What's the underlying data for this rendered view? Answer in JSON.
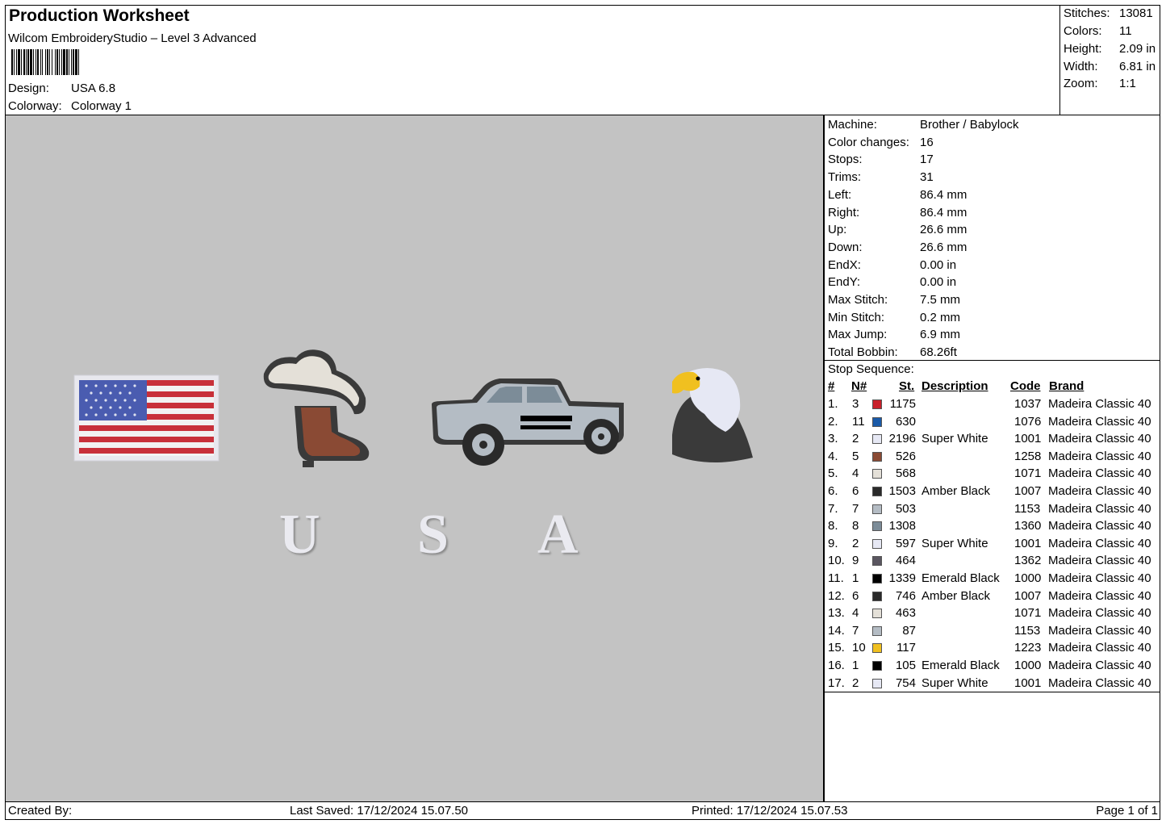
{
  "header": {
    "title": "Production Worksheet",
    "software": "Wilcom EmbroideryStudio – Level 3 Advanced",
    "design_label": "Design:",
    "design_value": "USA 6.8",
    "colorway_label": "Colorway:",
    "colorway_value": "Colorway 1"
  },
  "stats": [
    {
      "label": "Stitches:",
      "value": "13081"
    },
    {
      "label": "Colors:",
      "value": "11"
    },
    {
      "label": "Height:",
      "value": "2.09 in"
    },
    {
      "label": "Width:",
      "value": "6.81 in"
    },
    {
      "label": "Zoom:",
      "value": "1:1"
    }
  ],
  "machine_info": [
    {
      "label": "Machine:",
      "value": "Brother / Babylock"
    },
    {
      "label": "Color changes:",
      "value": "16"
    },
    {
      "label": "Stops:",
      "value": "17"
    },
    {
      "label": "Trims:",
      "value": "31"
    },
    {
      "label": "Left:",
      "value": "86.4 mm"
    },
    {
      "label": "Right:",
      "value": "86.4 mm"
    },
    {
      "label": "Up:",
      "value": "26.6 mm"
    },
    {
      "label": "Down:",
      "value": "26.6 mm"
    },
    {
      "label": "EndX:",
      "value": "0.00 in"
    },
    {
      "label": "EndY:",
      "value": "0.00 in"
    },
    {
      "label": "Max Stitch:",
      "value": "7.5 mm"
    },
    {
      "label": "Min Stitch:",
      "value": "0.2 mm"
    },
    {
      "label": "Max Jump:",
      "value": "6.9 mm"
    },
    {
      "label": "Total Bobbin:",
      "value": "68.26ft"
    }
  ],
  "stop_sequence": {
    "title": "Stop Sequence:",
    "columns": {
      "num": "#",
      "n": "N#",
      "st": "St.",
      "description": "Description",
      "code": "Code",
      "brand": "Brand"
    },
    "rows": [
      {
        "num": "1.",
        "n": "3",
        "color": "#c8202a",
        "st": "1175",
        "description": "",
        "code": "1037",
        "brand": "Madeira Classic 40"
      },
      {
        "num": "2.",
        "n": "11",
        "color": "#1a5aa8",
        "st": "630",
        "description": "",
        "code": "1076",
        "brand": "Madeira Classic 40"
      },
      {
        "num": "3.",
        "n": "2",
        "color": "#e6e8f4",
        "st": "2196",
        "description": "Super White",
        "code": "1001",
        "brand": "Madeira Classic 40"
      },
      {
        "num": "4.",
        "n": "5",
        "color": "#8a4a34",
        "st": "526",
        "description": "",
        "code": "1258",
        "brand": "Madeira Classic 40"
      },
      {
        "num": "5.",
        "n": "4",
        "color": "#e4e0d8",
        "st": "568",
        "description": "",
        "code": "1071",
        "brand": "Madeira Classic 40"
      },
      {
        "num": "6.",
        "n": "6",
        "color": "#2a2a2a",
        "st": "1503",
        "description": "Amber Black",
        "code": "1007",
        "brand": "Madeira Classic 40"
      },
      {
        "num": "7.",
        "n": "7",
        "color": "#b4bcc4",
        "st": "503",
        "description": "",
        "code": "1153",
        "brand": "Madeira Classic 40"
      },
      {
        "num": "8.",
        "n": "8",
        "color": "#7c8c98",
        "st": "1308",
        "description": "",
        "code": "1360",
        "brand": "Madeira Classic 40"
      },
      {
        "num": "9.",
        "n": "2",
        "color": "#e6e8f4",
        "st": "597",
        "description": "Super White",
        "code": "1001",
        "brand": "Madeira Classic 40"
      },
      {
        "num": "10.",
        "n": "9",
        "color": "#5a5660",
        "st": "464",
        "description": "",
        "code": "1362",
        "brand": "Madeira Classic 40"
      },
      {
        "num": "11.",
        "n": "1",
        "color": "#000000",
        "st": "1339",
        "description": "Emerald Black",
        "code": "1000",
        "brand": "Madeira Classic 40"
      },
      {
        "num": "12.",
        "n": "6",
        "color": "#2a2a2a",
        "st": "746",
        "description": "Amber Black",
        "code": "1007",
        "brand": "Madeira Classic 40"
      },
      {
        "num": "13.",
        "n": "4",
        "color": "#e4e0d8",
        "st": "463",
        "description": "",
        "code": "1071",
        "brand": "Madeira Classic 40"
      },
      {
        "num": "14.",
        "n": "7",
        "color": "#b4bcc4",
        "st": "87",
        "description": "",
        "code": "1153",
        "brand": "Madeira Classic 40"
      },
      {
        "num": "15.",
        "n": "10",
        "color": "#f0c020",
        "st": "117",
        "description": "",
        "code": "1223",
        "brand": "Madeira Classic 40"
      },
      {
        "num": "16.",
        "n": "1",
        "color": "#000000",
        "st": "105",
        "description": "Emerald Black",
        "code": "1000",
        "brand": "Madeira Classic 40"
      },
      {
        "num": "17.",
        "n": "2",
        "color": "#e6e8f4",
        "st": "754",
        "description": "Super White",
        "code": "1001",
        "brand": "Madeira Classic 40"
      }
    ]
  },
  "design_text": {
    "letters": [
      "U",
      "S",
      "A"
    ]
  },
  "footer": {
    "created_by": "Created By:",
    "last_saved": "Last Saved: 17/12/2024 15.07.50",
    "printed": "Printed: 17/12/2024 15.07.53",
    "page": "Page 1 of 1"
  },
  "colors": {
    "canvas_bg": "#c3c3c3"
  }
}
